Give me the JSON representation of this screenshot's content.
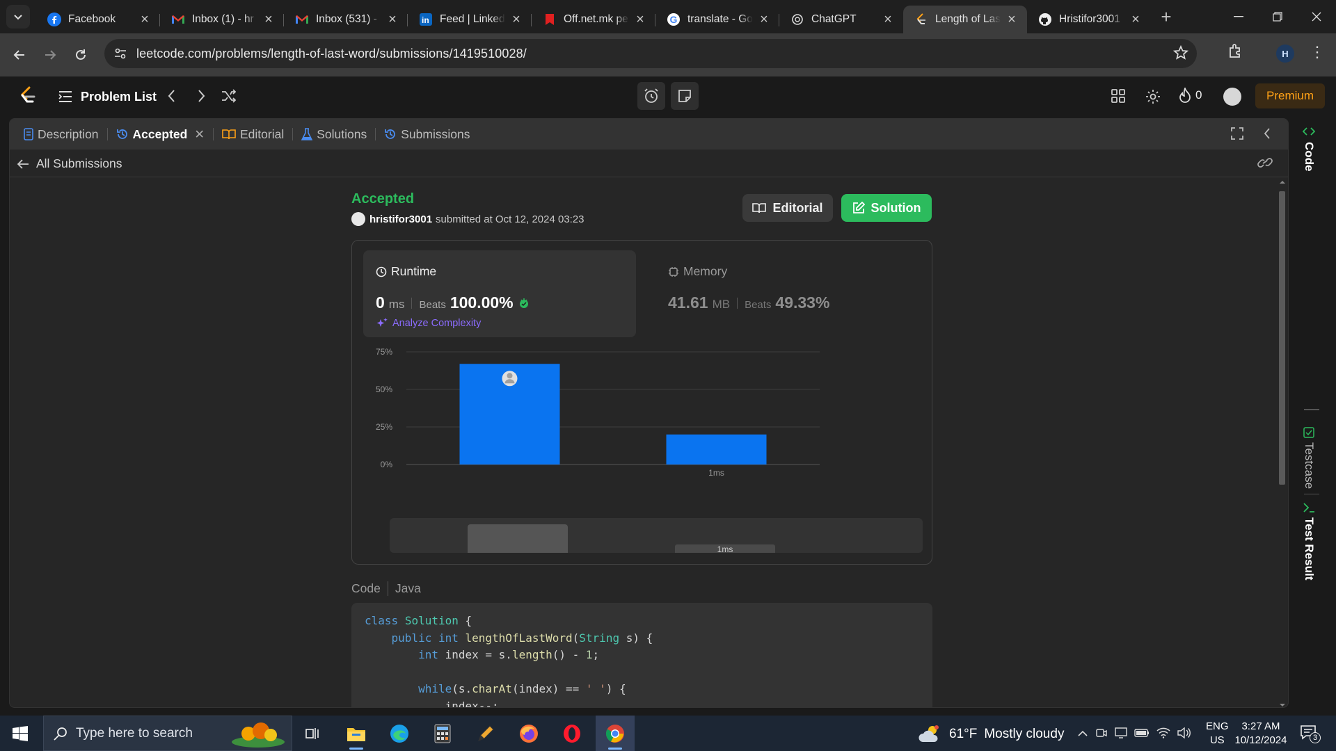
{
  "browser": {
    "tabs": [
      {
        "title": "Facebook",
        "icon": "facebook-icon"
      },
      {
        "title": "Inbox (1) - hr",
        "icon": "gmail-icon"
      },
      {
        "title": "Inbox (531) -",
        "icon": "gmail-icon"
      },
      {
        "title": "Feed | Linked",
        "icon": "linkedin-icon"
      },
      {
        "title": "Off.net.mk pe",
        "icon": "bookmark-icon"
      },
      {
        "title": "translate - Go",
        "icon": "google-icon"
      },
      {
        "title": "ChatGPT",
        "icon": "chatgpt-icon"
      },
      {
        "title": "Length of Las",
        "icon": "leetcode-icon",
        "active": true
      },
      {
        "title": "Hristifor3001",
        "icon": "github-icon"
      }
    ],
    "url": "leetcode.com/problems/length-of-last-word/submissions/1419510028/",
    "profile_initial": "H"
  },
  "header": {
    "problem_list_label": "Problem List",
    "streak_count": "0",
    "premium_label": "Premium"
  },
  "panel_tabs": {
    "description": "Description",
    "accepted": "Accepted",
    "editorial": "Editorial",
    "solutions": "Solutions",
    "submissions": "Submissions"
  },
  "all_submissions_label": "All Submissions",
  "submission": {
    "status": "Accepted",
    "username": "hristifor3001",
    "submitted_text": "submitted at Oct 12, 2024 03:23",
    "editorial_btn": "Editorial",
    "solution_btn": "Solution"
  },
  "runtime": {
    "title": "Runtime",
    "value": "0",
    "unit": "ms",
    "beats_label": "Beats",
    "beats_value": "100.00%",
    "analyze_label": "Analyze Complexity"
  },
  "memory": {
    "title": "Memory",
    "value": "41.61",
    "unit": "MB",
    "beats_label": "Beats",
    "beats_value": "49.33%"
  },
  "chart_data": {
    "type": "bar",
    "categories": [
      "",
      "1ms"
    ],
    "values": [
      67,
      20
    ],
    "yticks": [
      "0%",
      "25%",
      "50%",
      "75%"
    ],
    "ylim": [
      0,
      75
    ],
    "bar_color": "#0a74f0",
    "grid": true,
    "scrubber_label": "1ms"
  },
  "code": {
    "label": "Code",
    "language": "Java",
    "lines": [
      "class Solution {",
      "    public int lengthOfLastWord(String s) {",
      "        int index = s.length() - 1;",
      "",
      "        while(s.charAt(index) == ' ') {",
      "            index--;"
    ]
  },
  "right_rail": {
    "code_label": "Code",
    "testcase_label": "Testcase",
    "test_result_label": "Test Result"
  },
  "taskbar": {
    "search_placeholder": "Type here to search",
    "weather_temp": "61°F",
    "weather_desc": "Mostly cloudy",
    "lang_line1": "ENG",
    "lang_line2": "US",
    "time": "3:27 AM",
    "date": "10/12/2024",
    "notification_count": "3"
  },
  "colors": {
    "accent_green": "#2cbb5d",
    "premium_orange": "#ffa116",
    "chart_blue": "#0a74f0"
  }
}
